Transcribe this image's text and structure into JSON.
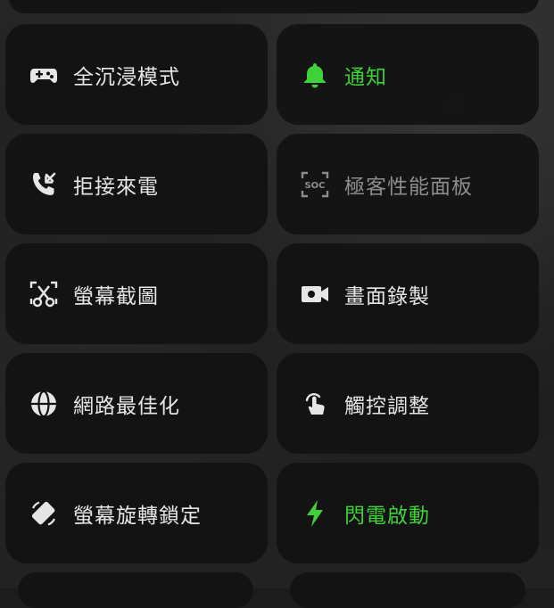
{
  "colors": {
    "active": "#3fd13a",
    "text": "#e6e6e6",
    "disabled_text": "#8c8c8c",
    "tile_bg": "#121212"
  },
  "tiles": [
    {
      "label": "全沉浸模式",
      "icon": "gamepad-icon",
      "state": "normal"
    },
    {
      "label": "通知",
      "icon": "bell-icon",
      "state": "active"
    },
    {
      "label": "拒接來電",
      "icon": "missed-call-icon",
      "state": "normal"
    },
    {
      "label": "極客性能面板",
      "icon": "soc-icon",
      "state": "disabled"
    },
    {
      "label": "螢幕截圖",
      "icon": "screenshot-scissors-icon",
      "state": "normal"
    },
    {
      "label": "畫面錄製",
      "icon": "video-camera-icon",
      "state": "normal"
    },
    {
      "label": "網路最佳化",
      "icon": "globe-icon",
      "state": "normal"
    },
    {
      "label": "觸控調整",
      "icon": "touch-hand-icon",
      "state": "normal"
    },
    {
      "label": "螢幕旋轉鎖定",
      "icon": "rotation-lock-icon",
      "state": "normal"
    },
    {
      "label": "閃電啟動",
      "icon": "lightning-icon",
      "state": "active"
    }
  ],
  "icon_text": {
    "soc": "SOC"
  }
}
